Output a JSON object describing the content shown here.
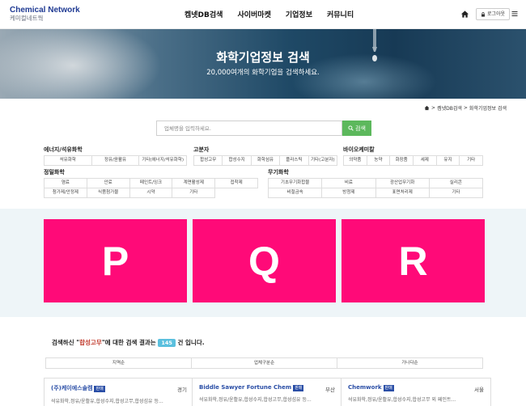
{
  "header": {
    "logo_en": "Chemical Network",
    "logo_ko": "케미컬네트웍",
    "nav": [
      "켐넷DB검색",
      "사이버마켓",
      "기업정보",
      "커뮤니티"
    ],
    "login_label": "로그아웃"
  },
  "hero": {
    "title": "화학기업정보 검색",
    "subtitle": "20,000여개의 화학기업을 검색하세요."
  },
  "breadcrumb": [
    "켐넷DB검색",
    "화학기업정보 검색"
  ],
  "search": {
    "placeholder": "업체명을 입력하세요.",
    "button_label": "검색"
  },
  "categories": {
    "energy": {
      "title": "에너지/석유화학",
      "items": [
        "석유화학",
        "정유/윤활유",
        "기타(에너지/석유화학)"
      ]
    },
    "polymer": {
      "title": "고분자",
      "items": [
        "합성고무",
        "합성수지",
        "화학섬유",
        "플라스틱",
        "기타(고분자)"
      ]
    },
    "bio": {
      "title": "바이오케미칼",
      "items": [
        "의약품",
        "농약",
        "화장품",
        "세제",
        "유지",
        "기타"
      ]
    },
    "fine": {
      "title": "정밀화학",
      "items": [
        "염료",
        "안료",
        "페인트/잉크",
        "계면활성제",
        "접착제",
        "첨가제/안정제",
        "식품첨가물",
        "시약",
        "기타"
      ]
    },
    "inorganic": {
      "title": "무기화학",
      "items": [
        "기초무기화합물",
        "비료",
        "광산업무기화",
        "실리콘",
        "비철금속",
        "방청제",
        "표면처리제",
        "기타"
      ]
    }
  },
  "featured": [
    "P",
    "Q",
    "R"
  ],
  "results": {
    "prefix": "검색하신 \"",
    "keyword": "합성고무",
    "middle": "\"에 대한 검색 결과는",
    "count": "145",
    "suffix": "건 입니다.",
    "sort_tabs": [
      "지역순",
      "업체구분순",
      "가나다순"
    ],
    "items": [
      {
        "name": "(주)케이에스솔켐",
        "badge": "판매",
        "region": "경기",
        "desc": "석유화학,정유/윤활유,합성수지,합성고무,합성섬유 등..."
      },
      {
        "name": "Biddle Sawyer Fortune Chem",
        "badge": "판매",
        "region": "부산",
        "desc": "석유화학,정유/윤활유,합성수지,합성고무,합성섬유 등..."
      },
      {
        "name": "Chemwork",
        "badge": "판매",
        "region": "서울",
        "desc": "석유화학,정유/윤활유,합성수지,합성고무 외 페인트..."
      }
    ]
  },
  "colors": {
    "brand": "#1f3a93",
    "search_button": "#5cb85c",
    "featured_card": "#ff0a78",
    "count_badge": "#5bc0de",
    "keyword": "#c0392b"
  }
}
